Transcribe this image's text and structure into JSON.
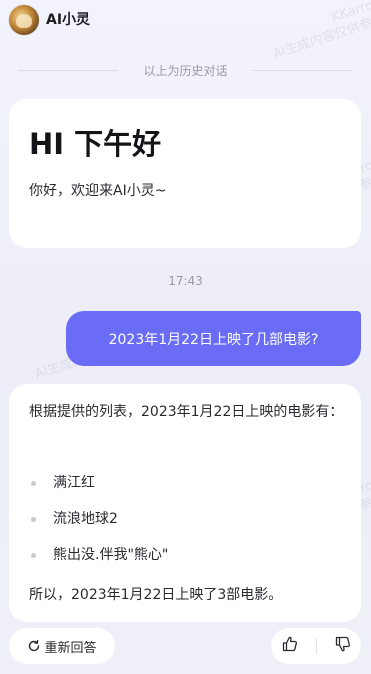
{
  "header": {
    "app_name": "AI小灵"
  },
  "history_divider": "以上为历史对话",
  "greeting": {
    "title": "HI 下午好",
    "subtitle": "你好，欢迎来AI小灵~"
  },
  "time": "17:43",
  "user_message": "2023年1月22日上映了几部电影?",
  "answer": {
    "intro": "根据提供的列表，2023年1月22日上映的电影有：",
    "items": [
      "满江红",
      "流浪地球2",
      "熊出没.伴我\"熊心\""
    ],
    "outro": "所以，2023年1月22日上映了3部电影。"
  },
  "actions": {
    "regenerate_label": "重新回答"
  },
  "watermark": {
    "line1": "KKarros",
    "line2": "AI生成内容仅供参考"
  },
  "colors": {
    "accent": "#6a6cf5",
    "background": "#f1f1f9",
    "card": "#ffffff"
  },
  "icons": {
    "regenerate": "refresh-icon",
    "like": "thumbs-up-icon",
    "dislike": "thumbs-down-icon"
  }
}
